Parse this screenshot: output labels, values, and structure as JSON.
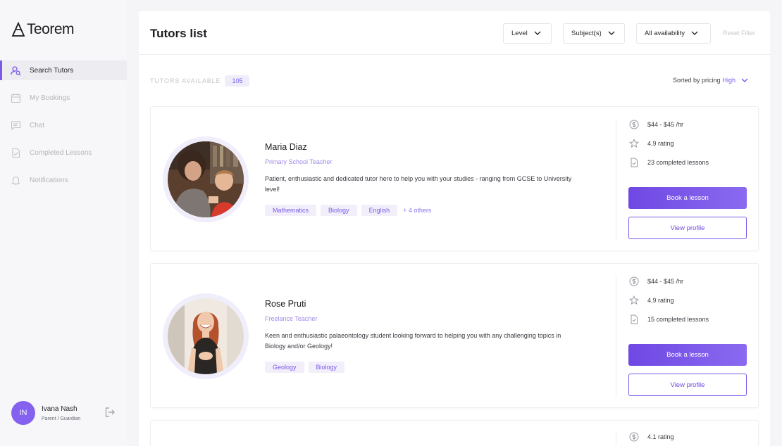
{
  "brand": {
    "name": "Teorem",
    "accent": "#7b5ae8"
  },
  "sidebar": {
    "items": [
      {
        "label": "Search Tutors",
        "icon": "search-user-icon",
        "active": true
      },
      {
        "label": "My Bookings",
        "icon": "calendar-icon",
        "active": false
      },
      {
        "label": "Chat",
        "icon": "chat-icon",
        "active": false
      },
      {
        "label": "Completed Lessons",
        "icon": "document-check-icon",
        "active": false
      },
      {
        "label": "Notifications",
        "icon": "bell-icon",
        "active": false
      }
    ],
    "user": {
      "initials": "IN",
      "name": "Ivana Nash",
      "role": "Parent / Guardian"
    }
  },
  "header": {
    "title": "Tutors list",
    "filters": {
      "level": "Level",
      "subjects": "Subject(s)",
      "availability": "All availability"
    },
    "reset": "Reset Filter"
  },
  "summary": {
    "label": "TUTORS AVAILABLE",
    "count": "105",
    "sort_prefix": "Sorted by pricing",
    "sort_value": "High"
  },
  "tutors": [
    {
      "name": "Maria Diaz",
      "role": "Primary School Teacher",
      "description": "Patient, enthusiastic and dedicated tutor here to help you with your studies - ranging from GCSE to University level!",
      "tags": [
        "Mathematics",
        "Biology",
        "English"
      ],
      "others": "+ 4 others",
      "price": "$44 - $45 /hr",
      "rating": "4.9 rating",
      "lessons": "23 completed lessons",
      "book_label": "Book a lesson",
      "view_label": "View profile"
    },
    {
      "name": "Rose Pruti",
      "role": "Freelance Teacher",
      "description": "Keen and enthusiastic palaeontology student looking forward to helping you with any challenging topics in Biology and/or Geology!",
      "tags": [
        "Geology",
        "Biology"
      ],
      "price": "$44 - $45 /hr",
      "rating": "4.9 rating",
      "lessons": "15 completed lessons",
      "book_label": "Book a lesson",
      "view_label": "View profile"
    },
    {
      "rating": "4.1 rating"
    }
  ]
}
